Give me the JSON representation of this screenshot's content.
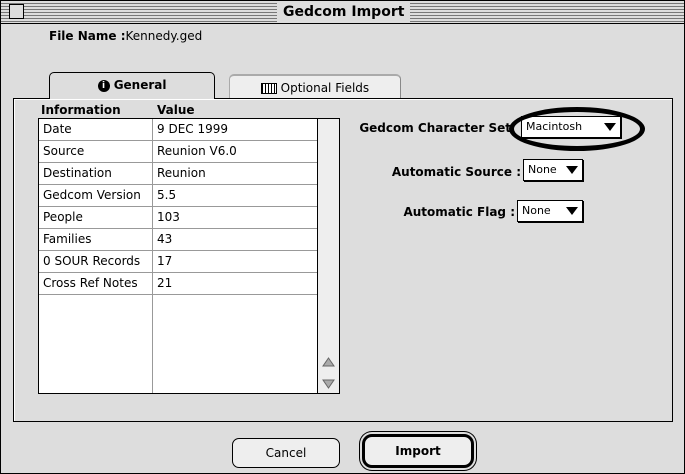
{
  "window": {
    "title": "Gedcom Import"
  },
  "file": {
    "label": "File Name :",
    "value": "Kennedy.ged"
  },
  "tabs": [
    {
      "label": "General",
      "icon": "info-icon",
      "selected": true
    },
    {
      "label": "Optional Fields",
      "icon": "keyboard-icon",
      "selected": false
    }
  ],
  "table": {
    "headers": [
      "Information",
      "Value"
    ],
    "rows": [
      [
        "Date",
        "9 DEC 1999"
      ],
      [
        "Source",
        "Reunion V6.0"
      ],
      [
        "Destination",
        "Reunion"
      ],
      [
        "Gedcom Version",
        "5.5"
      ],
      [
        "People",
        "103"
      ],
      [
        "Families",
        "43"
      ],
      [
        "0 SOUR Records",
        "17"
      ],
      [
        "Cross Ref Notes",
        "21"
      ]
    ]
  },
  "options": {
    "charset": {
      "label": "Gedcom Character Set",
      "value": "Macintosh"
    },
    "auto_source": {
      "label": "Automatic Source :",
      "value": "None"
    },
    "auto_flag": {
      "label": "Automatic Flag :",
      "value": "None"
    }
  },
  "buttons": {
    "cancel": "Cancel",
    "import": "Import"
  }
}
